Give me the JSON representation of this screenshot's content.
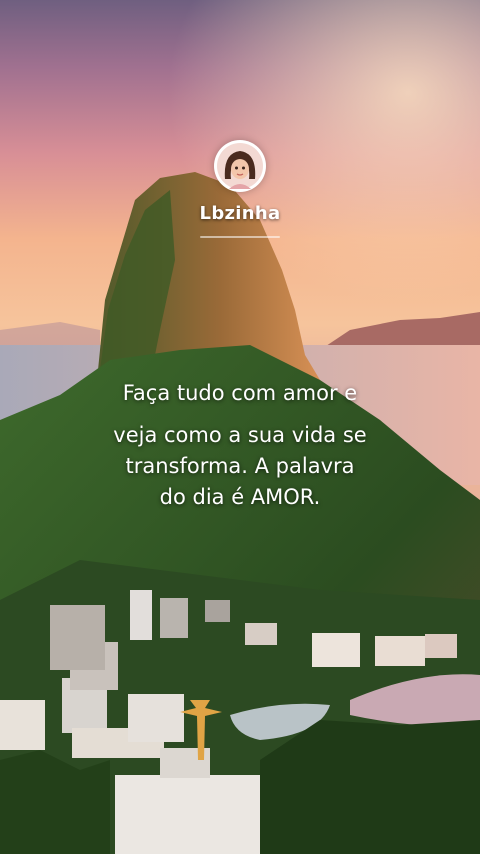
{
  "profile": {
    "username": "Lbzinha",
    "avatar_icon": "avatar-icon"
  },
  "quote": {
    "line1": "Faça tudo com amor e",
    "line2": "veja como a sua vida se",
    "line3": "transforma. A palavra",
    "line4": "do dia é AMOR."
  },
  "colors": {
    "sky_top": "#8f7090",
    "sky_mid": "#f0a880",
    "mountain": "#3c5a2c",
    "text": "#ffffff"
  }
}
